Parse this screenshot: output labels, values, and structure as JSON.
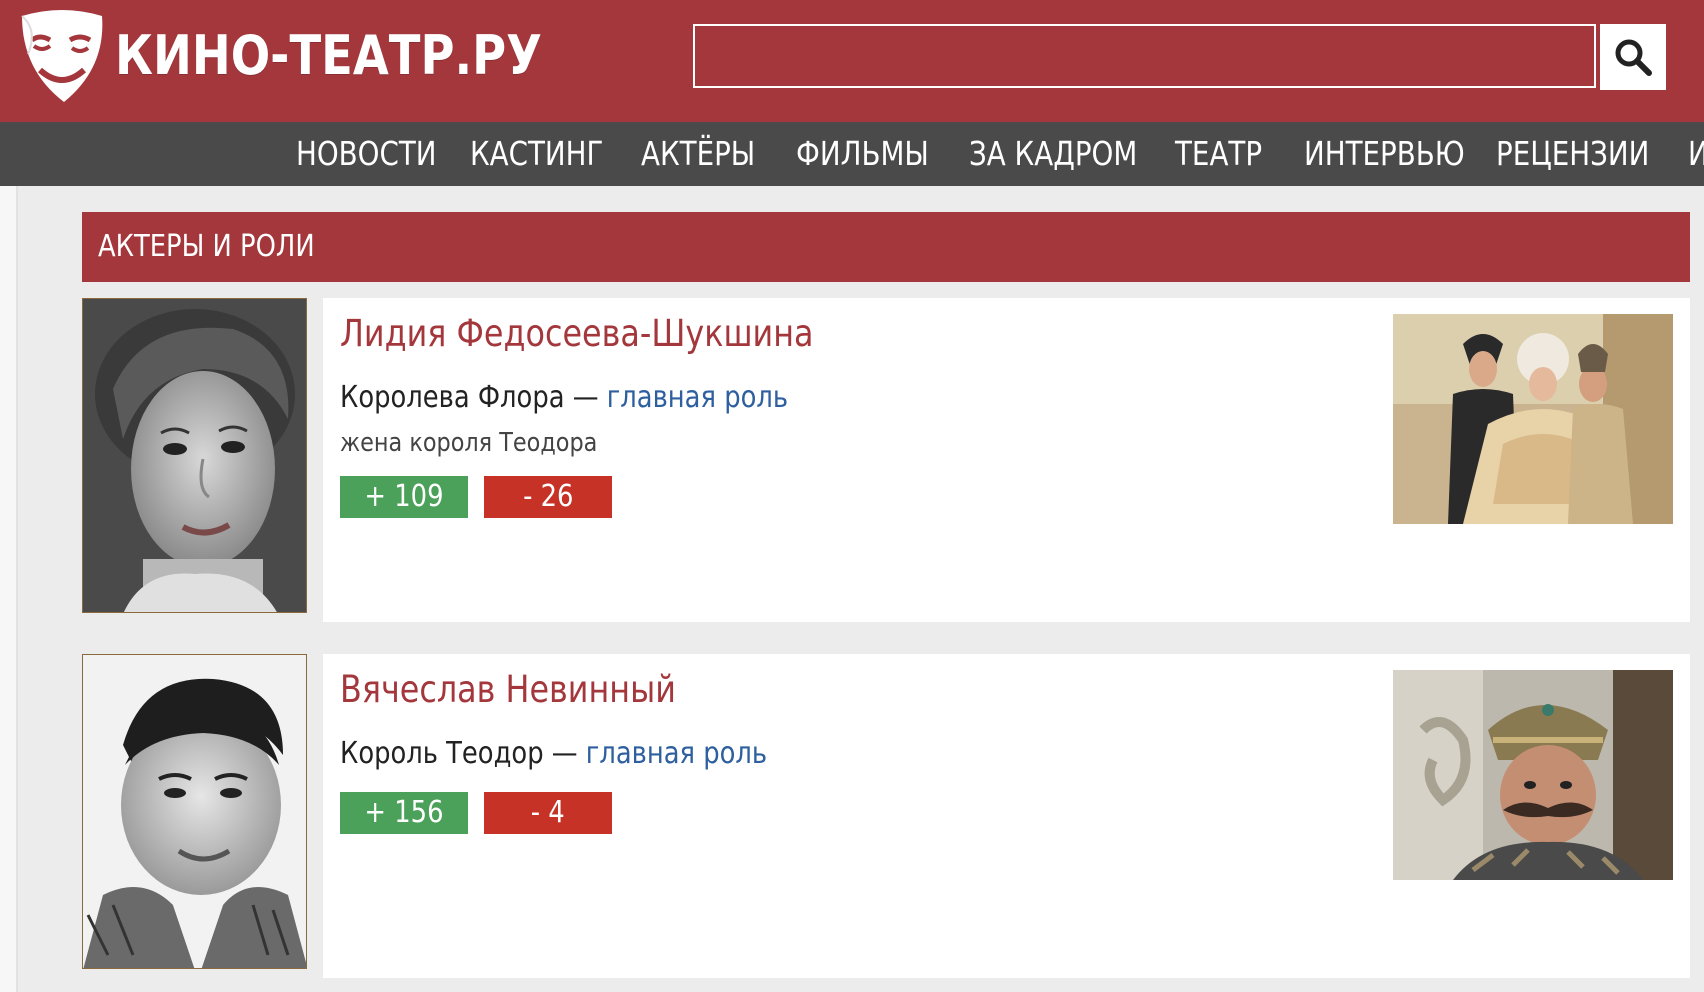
{
  "header": {
    "logo_text": "КИНО-ТЕАТР.РУ",
    "search_value": "",
    "brand_color": "#a3373c"
  },
  "nav": {
    "items": [
      {
        "label": "НОВОСТИ"
      },
      {
        "label": "КАСТИНГ"
      },
      {
        "label": "АКТЁРЫ"
      },
      {
        "label": "ФИЛЬМЫ"
      },
      {
        "label": "ЗА КАДРОМ"
      },
      {
        "label": "ТЕАТР"
      },
      {
        "label": "ИНТЕРВЬЮ"
      },
      {
        "label": "РЕЦЕНЗИИ"
      },
      {
        "label": "И"
      }
    ]
  },
  "section": {
    "title": "АКТЕРЫ И РОЛИ"
  },
  "actors": [
    {
      "name": "Лидия Федосеева-Шукшина",
      "role": "Королева Флора",
      "dash": " — ",
      "role_type": "главная роль",
      "description": "жена короля Теодора",
      "votes_up": "+ 109",
      "votes_down": "- 26"
    },
    {
      "name": "Вячеслав Невинный",
      "role": "Король Теодор",
      "dash": " — ",
      "role_type": "главная роль",
      "description": "",
      "votes_up": "+ 156",
      "votes_down": "- 4"
    }
  ],
  "colors": {
    "vote_up": "#4ba05a",
    "vote_down": "#c63326",
    "link": "#2e5f9e",
    "nav_bg": "#4a4a4a"
  }
}
